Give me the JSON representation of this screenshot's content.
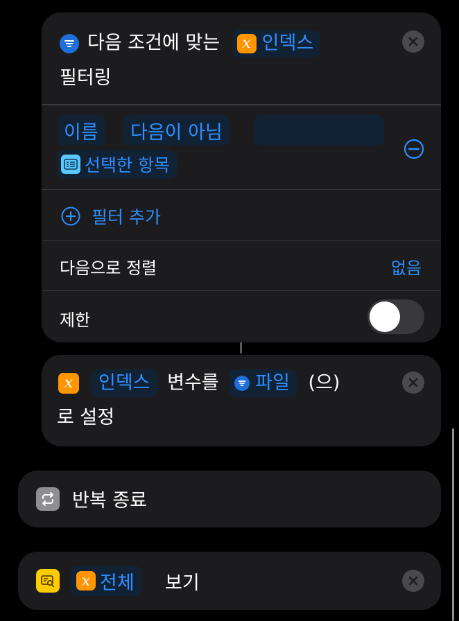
{
  "filter_action": {
    "title_part1": "다음 조건에 맞는",
    "variable_token": "인덱스",
    "title_part2": "필터링",
    "condition": {
      "field": "이름",
      "operator": "다음이 아님",
      "value_token": "선택한 항목"
    },
    "add_filter_label": "필터 추가",
    "sort_label": "다음으로 정렬",
    "sort_value": "없음",
    "limit_label": "제한",
    "limit_enabled": false
  },
  "set_variable_action": {
    "var_token": "인덱스",
    "text_mid": "변수를",
    "value_token": "파일",
    "text_tail": "(으)",
    "text_line2": "로 설정"
  },
  "end_repeat_action": {
    "label": "반복 종료"
  },
  "show_action": {
    "var_token": "전체",
    "label": "보기"
  },
  "colors": {
    "accent": "#2e8fff",
    "variable_orange": "#ff9500",
    "show_yellow": "#ffcc00",
    "card_bg": "#1c1c1e"
  }
}
